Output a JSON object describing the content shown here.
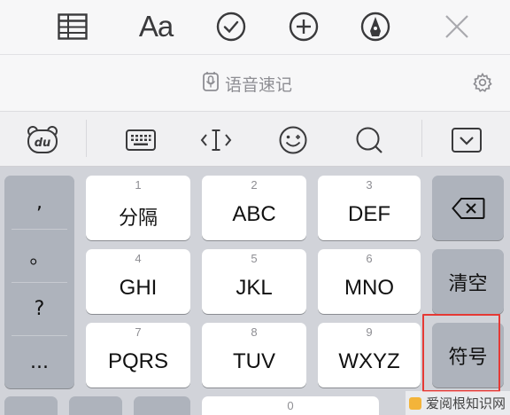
{
  "toolbar": {
    "items": [
      {
        "name": "table-icon"
      },
      {
        "name": "format-text",
        "label": "Aa"
      },
      {
        "name": "checklist-icon"
      },
      {
        "name": "add-icon"
      },
      {
        "name": "markup-pen-icon"
      },
      {
        "name": "close-icon"
      }
    ]
  },
  "voice_bar": {
    "label": "语音速记",
    "icon": "voice-note-icon",
    "settings_icon": "gear-icon"
  },
  "function_row": {
    "items": [
      "baidu-du-icon",
      "keyboard-icon",
      "cursor-move-icon",
      "emoji-icon",
      "search-icon",
      "hide-keyboard-icon"
    ]
  },
  "keyboard": {
    "punctuation": [
      ",",
      "。",
      "?",
      "..."
    ],
    "keys": [
      {
        "num": "1",
        "label": "分隔"
      },
      {
        "num": "2",
        "label": "ABC"
      },
      {
        "num": "3",
        "label": "DEF"
      },
      {
        "num": "4",
        "label": "GHI"
      },
      {
        "num": "5",
        "label": "JKL"
      },
      {
        "num": "6",
        "label": "MNO"
      },
      {
        "num": "7",
        "label": "PQRS"
      },
      {
        "num": "8",
        "label": "TUV"
      },
      {
        "num": "9",
        "label": "WXYZ"
      }
    ],
    "bottom_num": "0",
    "right_keys": {
      "delete_icon": "backspace-icon",
      "clear": "清空",
      "symbols": "符号"
    }
  },
  "watermark": "爱阅根知识网",
  "colors": {
    "highlight": "#e53935",
    "key_bg": "#ffffff",
    "function_key_bg": "#aeb3bc",
    "keyboard_bg": "#d1d3d9"
  }
}
